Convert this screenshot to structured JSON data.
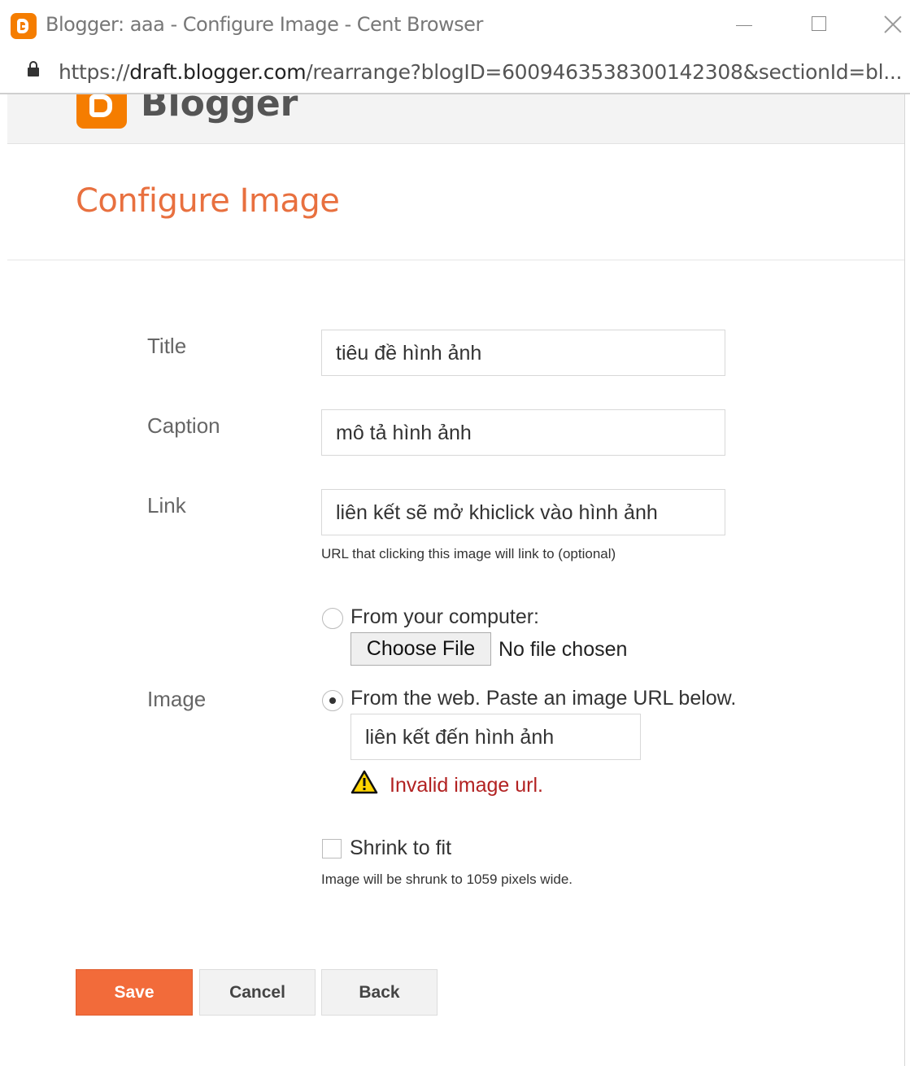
{
  "window": {
    "title": "Blogger: aaa - Configure Image - Cent Browser",
    "url_scheme": "https://",
    "url_domain": "draft.blogger.com",
    "url_path": "/rearrange?blogID=6009463538300142308&sectionId=bl..."
  },
  "header": {
    "brand": "Blogger"
  },
  "page": {
    "title": "Configure Image"
  },
  "form": {
    "title_label": "Title",
    "title_value": "tiêu đề hình ảnh",
    "caption_label": "Caption",
    "caption_value": "mô tả hình ảnh",
    "link_label": "Link",
    "link_value": "liên kết sẽ mở khiclick vào hình ảnh",
    "link_hint": "URL that clicking this image will link to (optional)",
    "image_label": "Image",
    "from_computer_label": "From your computer:",
    "choose_file_label": "Choose File",
    "file_status": "No file chosen",
    "from_web_label": "From the web. Paste an image URL below.",
    "web_url_value": "liên kết đến hình ảnh",
    "error_message": "Invalid image url.",
    "shrink_label": "Shrink to fit",
    "shrink_hint": "Image will be shrunk to 1059 pixels wide.",
    "selected_source": "web",
    "shrink_checked": false
  },
  "buttons": {
    "save": "Save",
    "cancel": "Cancel",
    "back": "Back"
  },
  "colors": {
    "accent": "#e8703f",
    "save_button": "#f26b3a",
    "error": "#b22222",
    "brand": "#f57d00"
  },
  "icons": {
    "app": "blogger-icon",
    "lock": "lock-icon",
    "warning": "warning-icon"
  }
}
